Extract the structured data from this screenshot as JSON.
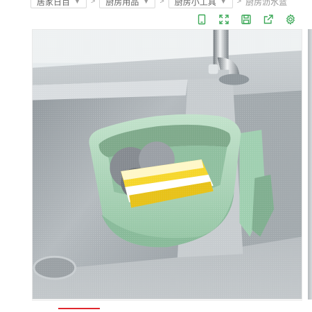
{
  "breadcrumb": {
    "items": [
      {
        "label": "居家日百"
      },
      {
        "label": "厨房用品"
      },
      {
        "label": "厨房小工具"
      }
    ],
    "separator": ">",
    "current": "厨房沥水篮"
  },
  "toolbar": {
    "buttons": [
      {
        "icon": "phone-icon"
      },
      {
        "icon": "expand-icon"
      },
      {
        "icon": "save-icon"
      },
      {
        "icon": "share-icon"
      },
      {
        "icon": "settings-icon"
      }
    ],
    "icon_color": "#3aa856"
  },
  "product_image": {
    "subject": "green sink drain basket with steel wool and sponge",
    "colors": {
      "basket": "#a7d3b4",
      "sponge": "#f5d623",
      "steel": "#8c9096",
      "sink": "#b9bec2"
    }
  },
  "accent_color": "#e0262d"
}
